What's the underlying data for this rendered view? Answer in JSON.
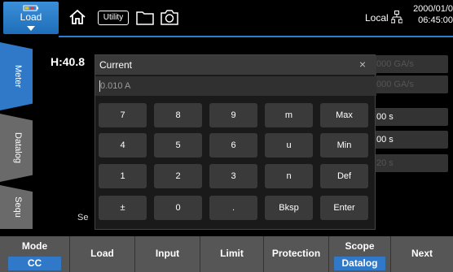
{
  "topbar": {
    "mode_tab": "Load",
    "utility_label": "Utility",
    "local_label": "Local",
    "date": "2000/01/0",
    "time": "06:45:00",
    "icons": [
      "home-icon",
      "folder-icon",
      "camera-icon",
      "network-icon",
      "battery-icon"
    ]
  },
  "side_tabs": [
    "Meter",
    "Datalog",
    "Sequ"
  ],
  "background": {
    "h_label": "H:40.8",
    "se_label": "Se",
    "fields": [
      "000 GA/s",
      "000 GA/s",
      "00 s",
      "00 s",
      "20 s"
    ]
  },
  "dialog": {
    "title": "Current",
    "close": "×",
    "input_value": "0.010 A",
    "keys": [
      [
        "7",
        "8",
        "9",
        "m",
        "Max"
      ],
      [
        "4",
        "5",
        "6",
        "u",
        "Min"
      ],
      [
        "1",
        "2",
        "3",
        "n",
        "Def"
      ],
      [
        "±",
        "0",
        ".",
        "Bksp",
        "Enter"
      ]
    ]
  },
  "softkeys": [
    {
      "label": "Mode",
      "value": "CC"
    },
    {
      "label": "Load"
    },
    {
      "label": "Input"
    },
    {
      "label": "Limit"
    },
    {
      "label": "Protection"
    },
    {
      "label": "Scope",
      "value": "Datalog"
    },
    {
      "label": "Next"
    }
  ],
  "colors": {
    "accent": "#2f79c8",
    "softkey_bg": "#565656",
    "key_bg": "#3a3a3a"
  }
}
